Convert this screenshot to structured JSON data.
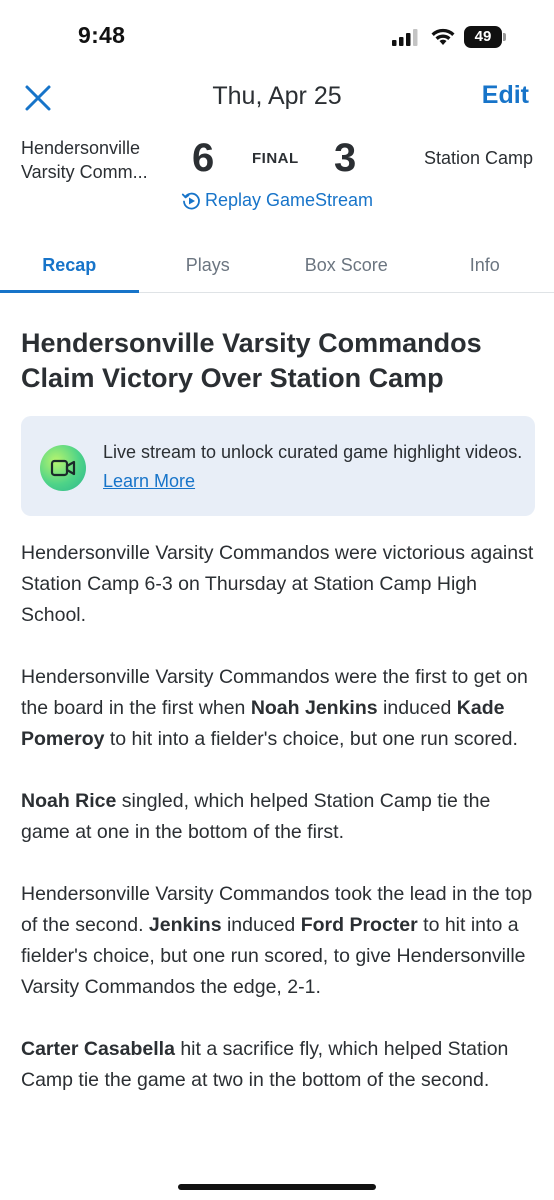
{
  "status_bar": {
    "time": "9:48",
    "battery": "49",
    "icons": [
      "signal-icon",
      "wifi-icon",
      "battery-icon"
    ]
  },
  "nav": {
    "title": "Thu, Apr 25",
    "edit_label": "Edit",
    "close_icon": "close-icon"
  },
  "game": {
    "away_team_line1": "Hendersonville",
    "away_team_line2": "Varsity Comm...",
    "away_score": "6",
    "status": "FINAL",
    "home_score": "3",
    "home_team": "Station Camp",
    "replay_label": "Replay GameStream"
  },
  "tabs": [
    {
      "label": "Recap",
      "active": true
    },
    {
      "label": "Plays",
      "active": false
    },
    {
      "label": "Box Score",
      "active": false
    },
    {
      "label": "Info",
      "active": false
    }
  ],
  "article": {
    "headline": "Hendersonville Varsity Commandos Claim Victory Over Station Camp",
    "banner": {
      "text": "Live stream to unlock curated game highlight videos.",
      "link": "Learn More",
      "icon": "video-camera-icon"
    },
    "paragraphs": [
      [
        {
          "t": "Hendersonville Varsity Commandos were victorious against Station Camp 6-3 on Thursday at Station Camp High School.",
          "b": false
        }
      ],
      [
        {
          "t": "Hendersonville Varsity Commandos were the first to get on the board in the first when ",
          "b": false
        },
        {
          "t": "Noah Jenkins",
          "b": true
        },
        {
          "t": " induced ",
          "b": false
        },
        {
          "t": "Kade Pomeroy",
          "b": true
        },
        {
          "t": " to hit into a fielder's choice, but one run scored.",
          "b": false
        }
      ],
      [
        {
          "t": "Noah Rice",
          "b": true
        },
        {
          "t": " singled, which helped Station Camp tie the game at one in the bottom of the first.",
          "b": false
        }
      ],
      [
        {
          "t": "Hendersonville Varsity Commandos took the lead in the top of the second. ",
          "b": false
        },
        {
          "t": "Jenkins",
          "b": true
        },
        {
          "t": " induced ",
          "b": false
        },
        {
          "t": "Ford Procter",
          "b": true
        },
        {
          "t": " to hit into a fielder's choice, but one run scored, to give Hendersonville Varsity Commandos the edge, 2-1.",
          "b": false
        }
      ],
      [
        {
          "t": "Carter Casabella",
          "b": true
        },
        {
          "t": " hit a sacrifice fly, which helped Station Camp tie the game at two in the bottom of the second.",
          "b": false
        }
      ]
    ]
  },
  "colors": {
    "accent": "#1774c9",
    "text": "#2b2f33",
    "muted": "#6b7580",
    "banner_bg": "#e8eef7"
  }
}
